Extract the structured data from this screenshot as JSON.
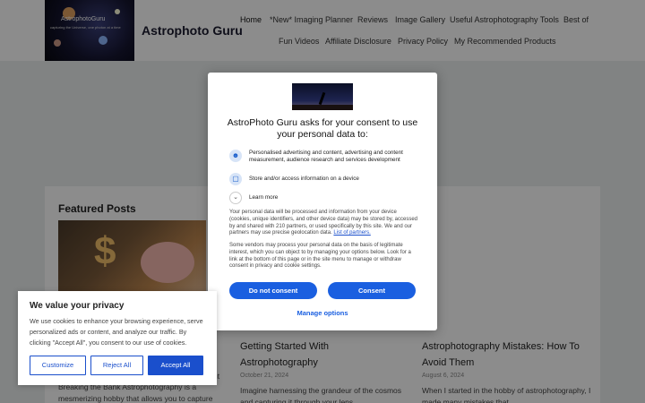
{
  "site": {
    "logo_text": "AstrophotoGuru",
    "logo_sub": "capturing the Universe, one photon at a time",
    "title": "Astrophoto Guru"
  },
  "nav": {
    "items": [
      "Home",
      "*New* Imaging Planner",
      "Reviews",
      "Image Gallery",
      "Useful Astrophotography Tools",
      "Best of",
      "Fun Videos",
      "Affiliate Disclosure",
      "Privacy Policy",
      "My Recommended Products"
    ]
  },
  "featured": {
    "heading": "Featured Posts",
    "posts": [
      {
        "title_line1": "",
        "excerpt": "Breaking the Bank Astrophotography is a mesmerizing hobby that allows you to capture",
        "partial_title": "ut"
      },
      {
        "title_line1": "Getting Started With",
        "title_line2": "Astrophotography",
        "date": "October 21, 2024",
        "excerpt": "Imagine harnessing the grandeur of the cosmos and capturing it through your lens."
      },
      {
        "title_line1": "Astrophotography Mistakes: How To",
        "title_line2": "Avoid Them",
        "date": "August 6, 2024",
        "excerpt": "When I started in the hobby of astrophotography, I made many mistakes that"
      }
    ]
  },
  "consent_modal": {
    "title": "AstroPhoto Guru asks for your consent to use your personal data to:",
    "purposes": [
      {
        "icon": "person-icon",
        "text": "Personalised advertising and content, advertising and content measurement, audience research and services development"
      },
      {
        "icon": "device-icon",
        "text": "Store and/or access information on a device"
      }
    ],
    "learn_more": "Learn more",
    "body1": "Your personal data will be processed and information from your device (cookies, unique identifiers, and other device data) may be stored by, accessed by and shared with 210 partners, or used specifically by this site. We and our partners may use precise geolocation data.",
    "partners_link": "List of partners.",
    "body2": "Some vendors may process your personal data on the basis of legitimate interest, which you can object to by managing your options below. Look for a link at the bottom of this page or in the site menu to manage or withdraw consent in privacy and cookie settings.",
    "do_not_consent": "Do not consent",
    "consent": "Consent",
    "manage_options": "Manage options"
  },
  "cookie_banner": {
    "title": "We value your privacy",
    "text": "We use cookies to enhance your browsing experience, serve personalized ads or content, and analyze our traffic. By clicking \"Accept All\", you consent to our use of cookies.",
    "customize": "Customize",
    "reject_all": "Reject All",
    "accept_all": "Accept All"
  },
  "colors": {
    "accent": "#1a5fe0",
    "cookie_accent": "#1a4fcc"
  }
}
